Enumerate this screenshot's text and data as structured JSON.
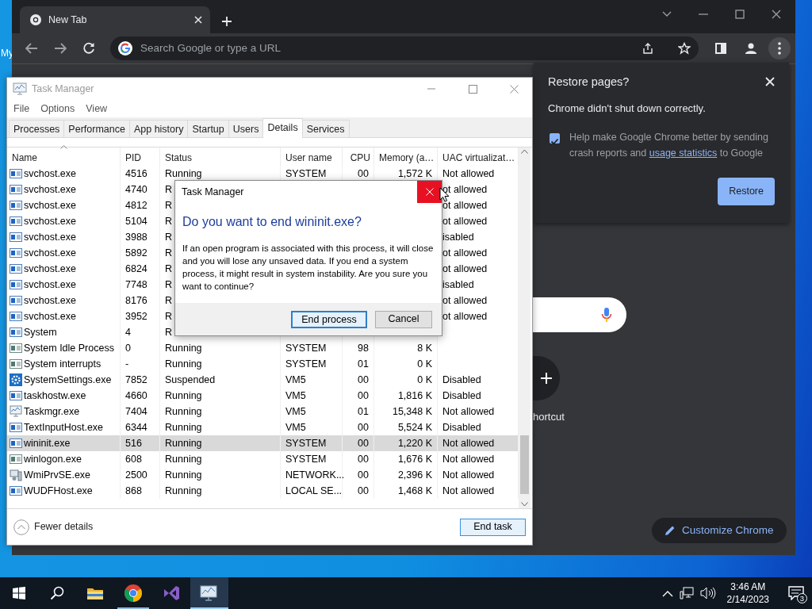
{
  "desktop": {
    "icon_label": "My"
  },
  "browser": {
    "tabs": [
      {
        "title": "New Tab",
        "selected": true
      }
    ],
    "omnibox": {
      "placeholder": "Search Google or type a URL"
    },
    "restore_bubble": {
      "title": "Restore pages?",
      "message": "Chrome didn't shut down correctly.",
      "consent": {
        "checked": true,
        "text_before": "Help make Google Chrome better by sending crash reports and ",
        "link": "usage statistics",
        "text_after": " to Google"
      },
      "button": "Restore"
    },
    "shortcut_label": "hortcut",
    "customize_button": "Customize Chrome"
  },
  "task_manager": {
    "title": "Task Manager",
    "menu": [
      "File",
      "Options",
      "View"
    ],
    "tabs": [
      {
        "label": "Processes",
        "selected": false
      },
      {
        "label": "Performance",
        "selected": false
      },
      {
        "label": "App history",
        "selected": false
      },
      {
        "label": "Startup",
        "selected": false
      },
      {
        "label": "Users",
        "selected": false
      },
      {
        "label": "Details",
        "selected": true
      },
      {
        "label": "Services",
        "selected": false
      }
    ],
    "columns": [
      {
        "label": "Name",
        "sorted": true
      },
      {
        "label": "PID",
        "sorted": false
      },
      {
        "label": "Status",
        "sorted": false
      },
      {
        "label": "User name",
        "sorted": false
      },
      {
        "label": "CPU",
        "sorted": false
      },
      {
        "label": "Memory (a…",
        "sorted": false
      },
      {
        "label": "UAC virtualizat…",
        "sorted": false
      }
    ],
    "rows": [
      {
        "kind": "app",
        "name": "svchost.exe",
        "pid": "4516",
        "status": "Running",
        "user": "SYSTEM",
        "cpu": "00",
        "memory": "1,572 K",
        "uac": "Not allowed",
        "selected": false
      },
      {
        "kind": "app",
        "name": "svchost.exe",
        "pid": "4740",
        "status": "R",
        "uac": "ot allowed",
        "selected": false
      },
      {
        "kind": "app",
        "name": "svchost.exe",
        "pid": "4812",
        "status": "R",
        "uac": "ot allowed",
        "selected": false
      },
      {
        "kind": "app",
        "name": "svchost.exe",
        "pid": "5104",
        "status": "R",
        "uac": "ot allowed",
        "selected": false
      },
      {
        "kind": "app",
        "name": "svchost.exe",
        "pid": "3988",
        "status": "R",
        "uac": "isabled",
        "selected": false
      },
      {
        "kind": "app",
        "name": "svchost.exe",
        "pid": "5892",
        "status": "R",
        "uac": "ot allowed",
        "selected": false
      },
      {
        "kind": "app",
        "name": "svchost.exe",
        "pid": "6824",
        "status": "R",
        "uac": "ot allowed",
        "selected": false
      },
      {
        "kind": "app",
        "name": "svchost.exe",
        "pid": "7748",
        "status": "R",
        "uac": "isabled",
        "selected": false
      },
      {
        "kind": "app",
        "name": "svchost.exe",
        "pid": "8176",
        "status": "R",
        "uac": "ot allowed",
        "selected": false
      },
      {
        "kind": "app",
        "name": "svchost.exe",
        "pid": "3952",
        "status": "R",
        "uac": "ot allowed",
        "selected": false
      },
      {
        "kind": "app",
        "name": "System",
        "pid": "4",
        "status": "R",
        "selected": false
      },
      {
        "kind": "system",
        "name": "System Idle Process",
        "pid": "0",
        "status": "Running",
        "user": "SYSTEM",
        "cpu": "98",
        "memory": "8 K",
        "selected": false
      },
      {
        "kind": "system",
        "name": "System interrupts",
        "pid": "-",
        "status": "Running",
        "user": "SYSTEM",
        "cpu": "01",
        "memory": "0 K",
        "selected": false
      },
      {
        "kind": "gear",
        "name": "SystemSettings.exe",
        "pid": "7852",
        "status": "Suspended",
        "user": "VM5",
        "cpu": "00",
        "memory": "0 K",
        "uac": "Disabled",
        "selected": false
      },
      {
        "kind": "app",
        "name": "taskhostw.exe",
        "pid": "4660",
        "status": "Running",
        "user": "VM5",
        "cpu": "00",
        "memory": "1,816 K",
        "uac": "Disabled",
        "selected": false
      },
      {
        "kind": "monitor",
        "name": "Taskmgr.exe",
        "pid": "7404",
        "status": "Running",
        "user": "VM5",
        "cpu": "01",
        "memory": "15,348 K",
        "uac": "Not allowed",
        "selected": false
      },
      {
        "kind": "app",
        "name": "TextInputHost.exe",
        "pid": "6344",
        "status": "Running",
        "user": "VM5",
        "cpu": "00",
        "memory": "5,524 K",
        "uac": "Disabled",
        "selected": false
      },
      {
        "kind": "app",
        "name": "wininit.exe",
        "pid": "516",
        "status": "Running",
        "user": "SYSTEM",
        "cpu": "00",
        "memory": "1,220 K",
        "uac": "Not allowed",
        "selected": true
      },
      {
        "kind": "system",
        "name": "winlogon.exe",
        "pid": "608",
        "status": "Running",
        "user": "SYSTEM",
        "cpu": "00",
        "memory": "1,676 K",
        "uac": "Not allowed",
        "selected": false
      },
      {
        "kind": "service",
        "name": "WmiPrvSE.exe",
        "pid": "2500",
        "status": "Running",
        "user": "NETWORK...",
        "cpu": "00",
        "memory": "2,396 K",
        "uac": "Not allowed",
        "selected": false
      },
      {
        "kind": "app",
        "name": "WUDFHost.exe",
        "pid": "868",
        "status": "Running",
        "user": "LOCAL SE...",
        "cpu": "00",
        "memory": "1,468 K",
        "uac": "Not allowed",
        "selected": false
      }
    ],
    "footer": {
      "toggle": "Fewer details",
      "button": "End task"
    }
  },
  "dialog": {
    "title": "Task Manager",
    "close_hovered": true,
    "heading": "Do you want to end wininit.exe?",
    "body": "If an open program is associated with this process, it will close and you will lose any unsaved data. If you end a system process, it might result in system instability. Are you sure you want to continue?",
    "buttons": [
      {
        "label": "End process",
        "default": true
      },
      {
        "label": "Cancel",
        "default": false
      }
    ]
  },
  "taskbar": {
    "apps": [
      {
        "kind": "explorer",
        "running": false,
        "selected": false
      },
      {
        "kind": "chrome",
        "running": true,
        "selected": false
      },
      {
        "kind": "studio",
        "running": false,
        "selected": false
      },
      {
        "kind": "taskmgr",
        "running": true,
        "selected": true
      }
    ],
    "clock": {
      "time": "3:46 AM",
      "date": "2/14/2023"
    },
    "notifications": {
      "count": "3"
    }
  }
}
